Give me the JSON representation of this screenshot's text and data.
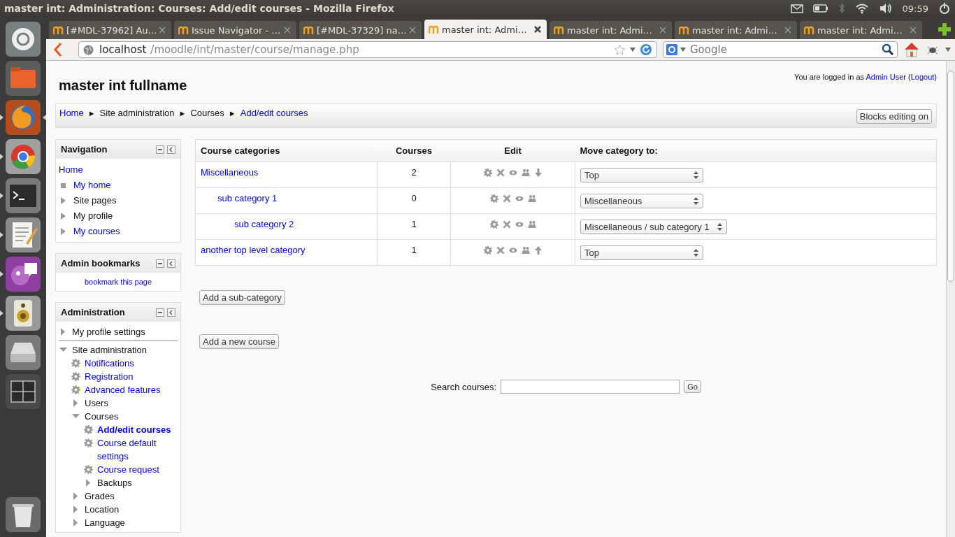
{
  "window": {
    "title": "master int: Administration: Courses: Add/edit courses - Mozilla Firefox"
  },
  "panel": {
    "time": "09:59"
  },
  "launcher": [
    {
      "kind": "dash",
      "running": false,
      "focused": false
    },
    {
      "kind": "files",
      "running": false,
      "focused": false
    },
    {
      "kind": "firefox",
      "running": true,
      "focused": true
    },
    {
      "kind": "chrome",
      "running": true,
      "focused": false
    },
    {
      "kind": "terminal",
      "running": true,
      "focused": false
    },
    {
      "kind": "editor",
      "running": true,
      "focused": false
    },
    {
      "kind": "chat",
      "running": true,
      "focused": false
    },
    {
      "kind": "speaker",
      "running": true,
      "focused": false
    },
    {
      "kind": "disk",
      "running": false,
      "focused": false
    },
    {
      "kind": "workspaces",
      "running": false,
      "focused": false
    },
    {
      "kind": "trash",
      "running": false,
      "focused": false
    }
  ],
  "tabs": [
    {
      "label": "[#MDL-37962] Au…",
      "selected": false
    },
    {
      "label": "Issue Navigator - …",
      "selected": false
    },
    {
      "label": "[#MDL-37329] na…",
      "selected": false
    },
    {
      "label": "master int: Admi…",
      "selected": true
    },
    {
      "label": "master int: Admi…",
      "selected": false
    },
    {
      "label": "master int: Admi…",
      "selected": false
    },
    {
      "label": "master int: Admi…",
      "selected": false
    }
  ],
  "address": {
    "host": "localhost",
    "path": "/moodle/int/master/course/manage.php"
  },
  "search": {
    "placeholder": "Google"
  },
  "page": {
    "site_name": "master int fullname",
    "login_info": {
      "text_before": "You are logged in as",
      "user": "Admin User",
      "open": "(",
      "logout": "Logout",
      "close": ")"
    },
    "breadcrumb": {
      "separator": "►",
      "items": [
        {
          "label": "Home",
          "link": true
        },
        {
          "label": "Site administration",
          "link": false
        },
        {
          "label": "Courses",
          "link": false
        },
        {
          "label": "Add/edit courses",
          "link": true
        }
      ]
    },
    "blocks_editing_button": "Blocks editing on"
  },
  "navigation": {
    "title": "Navigation",
    "items": [
      {
        "label": "Home",
        "kind": "plain",
        "link": true
      },
      {
        "label": "My home",
        "kind": "leaf",
        "link": true
      },
      {
        "label": "Site pages",
        "kind": "branch",
        "link": false,
        "expanded": false
      },
      {
        "label": "My profile",
        "kind": "branch",
        "link": false,
        "expanded": false
      },
      {
        "label": "My courses",
        "kind": "branch",
        "link": true,
        "expanded": false
      }
    ]
  },
  "admin_bookmarks": {
    "title": "Admin bookmarks",
    "link": "bookmark this page"
  },
  "administration": {
    "title": "Administration",
    "items": [
      {
        "label": "My profile settings",
        "kind": "branch",
        "link": false,
        "expanded": false,
        "selected": false
      },
      {
        "label": "Site administration",
        "kind": "branch",
        "link": false,
        "expanded": true,
        "selected": false,
        "children": [
          {
            "label": "Notifications",
            "kind": "setting",
            "link": true,
            "selected": false
          },
          {
            "label": "Registration",
            "kind": "setting",
            "link": true,
            "selected": false
          },
          {
            "label": "Advanced features",
            "kind": "setting",
            "link": true,
            "selected": false
          },
          {
            "label": "Users",
            "kind": "branch",
            "link": false,
            "expanded": false,
            "selected": false
          },
          {
            "label": "Courses",
            "kind": "branch",
            "link": false,
            "expanded": true,
            "selected": false,
            "children": [
              {
                "label": "Add/edit courses",
                "kind": "setting",
                "link": true,
                "selected": true
              },
              {
                "label": "Course default settings",
                "kind": "setting",
                "link": true,
                "selected": false
              },
              {
                "label": "Course request",
                "kind": "setting",
                "link": true,
                "selected": false
              },
              {
                "label": "Backups",
                "kind": "branch",
                "link": false,
                "expanded": false,
                "selected": false
              }
            ]
          },
          {
            "label": "Grades",
            "kind": "branch",
            "link": false,
            "expanded": false,
            "selected": false
          },
          {
            "label": "Location",
            "kind": "branch",
            "link": false,
            "expanded": false,
            "selected": false
          },
          {
            "label": "Language",
            "kind": "branch",
            "link": false,
            "expanded": false,
            "selected": false
          }
        ]
      }
    ]
  },
  "table": {
    "columns": [
      "Course categories",
      "Courses",
      "Edit",
      "Move category to:"
    ],
    "categories": [
      {
        "name": "Miscellaneous",
        "courses": "2",
        "actions": [
          {
            "kind": "settings"
          },
          {
            "kind": "delete"
          },
          {
            "kind": "hide"
          },
          {
            "kind": "roles"
          },
          {
            "kind": "down"
          }
        ],
        "move_to": "Top",
        "children": [
          {
            "name": "sub category 1",
            "courses": "0",
            "actions": [
              {
                "kind": "settings"
              },
              {
                "kind": "delete"
              },
              {
                "kind": "hide"
              },
              {
                "kind": "roles"
              }
            ],
            "move_to": "Miscellaneous",
            "children": [
              {
                "name": "sub category 2",
                "courses": "1",
                "actions": [
                  {
                    "kind": "settings"
                  },
                  {
                    "kind": "delete"
                  },
                  {
                    "kind": "hide"
                  },
                  {
                    "kind": "roles"
                  }
                ],
                "move_to": "Miscellaneous / sub category 1"
              }
            ]
          }
        ]
      },
      {
        "name": "another top level category",
        "courses": "1",
        "actions": [
          {
            "kind": "settings"
          },
          {
            "kind": "delete"
          },
          {
            "kind": "hide"
          },
          {
            "kind": "roles"
          },
          {
            "kind": "up"
          }
        ],
        "move_to": "Top"
      }
    ]
  },
  "buttons": {
    "add_subcategory": "Add a sub-category",
    "add_course": "Add a new course"
  },
  "course_search": {
    "label": "Search courses:",
    "button": "Go"
  }
}
